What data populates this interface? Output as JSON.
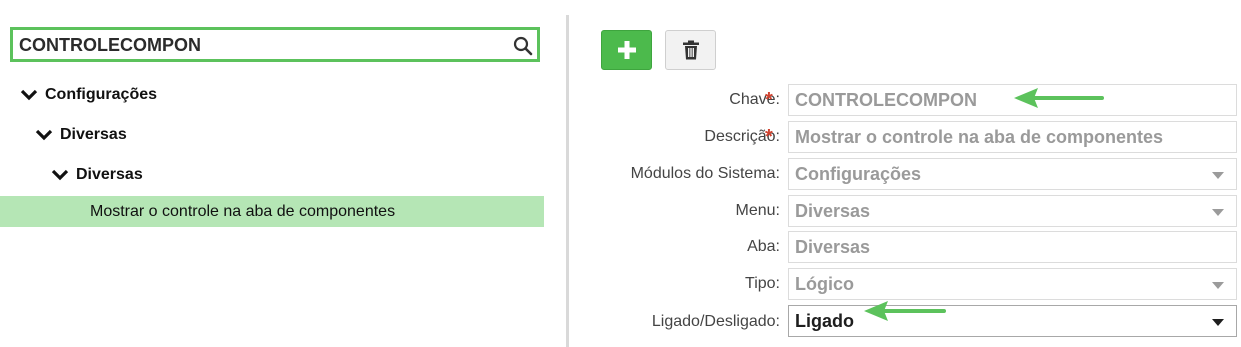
{
  "search": {
    "value": "CONTROLECOMPON",
    "icon": "search-icon"
  },
  "tree": {
    "level1": "Configurações",
    "level2": "Diversas",
    "level3": "Diversas",
    "leaf": "Mostrar o controle na aba de componentes"
  },
  "toolbar": {
    "add_icon": "plus-icon",
    "delete_icon": "trash-icon"
  },
  "form": {
    "chave": {
      "label": "Chave:",
      "value": "CONTROLECOMPON",
      "required": "*"
    },
    "descricao": {
      "label": "Descrição:",
      "value": "Mostrar o controle na aba de componentes",
      "required": "*"
    },
    "modulos": {
      "label": "Módulos do Sistema:",
      "value": "Configurações"
    },
    "menu": {
      "label": "Menu:",
      "value": "Diversas"
    },
    "aba": {
      "label": "Aba:",
      "value": "Diversas"
    },
    "tipo": {
      "label": "Tipo:",
      "value": "Lógico"
    },
    "ligado": {
      "label": "Ligado/Desligado:",
      "value": "Ligado"
    }
  },
  "colors": {
    "accent": "#4cba4c",
    "selection": "#b5e6b5",
    "required": "#d0422f"
  }
}
